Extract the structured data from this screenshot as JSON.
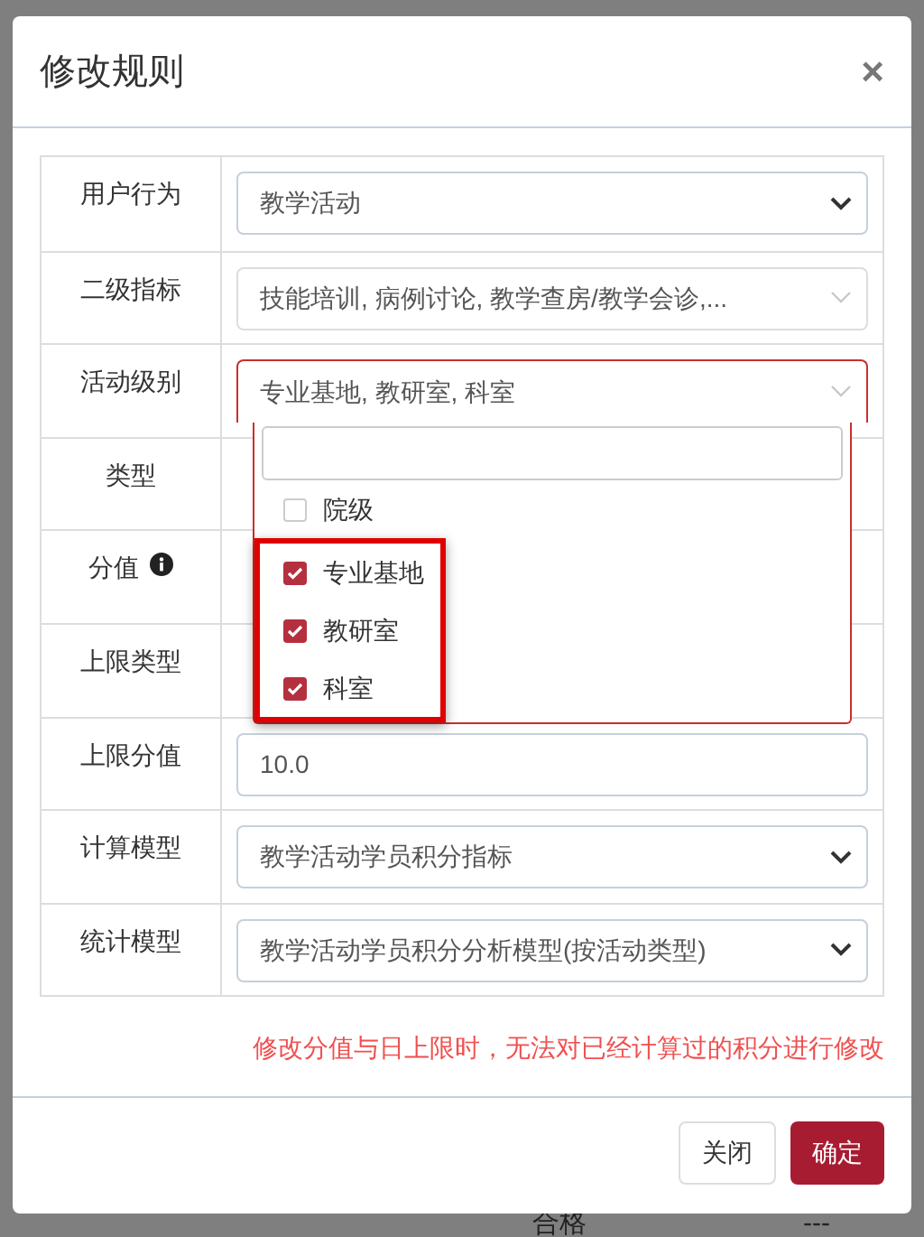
{
  "backdrop": {
    "texts": [
      "合格",
      "---"
    ]
  },
  "modal": {
    "title": "修改规则",
    "close": "×"
  },
  "rows": [
    {
      "label": "用户行为",
      "field": {
        "kind": "select",
        "value": "教学活动"
      }
    },
    {
      "label": "二级指标",
      "field": {
        "kind": "multiselect",
        "value": "技能培训, 病例讨论, 教学查房/教学会诊,...",
        "open": false
      }
    },
    {
      "label": "活动级别",
      "field": {
        "kind": "multiselect",
        "value": "专业基地, 教研室, 科室",
        "open": true,
        "options": [
          {
            "label": "院级",
            "checked": false,
            "highlighted": false
          },
          {
            "label": "专业基地",
            "checked": true,
            "highlighted": true
          },
          {
            "label": "教研室",
            "checked": true,
            "highlighted": true
          },
          {
            "label": "科室",
            "checked": true,
            "highlighted": true
          }
        ]
      }
    },
    {
      "label": "类型"
    },
    {
      "label": "分值",
      "info": true
    },
    {
      "label": "上限类型"
    },
    {
      "label": "上限分值",
      "field": {
        "kind": "input",
        "value": "10.0"
      }
    },
    {
      "label": "计算模型",
      "field": {
        "kind": "select",
        "value": "教学活动学员积分指标"
      }
    },
    {
      "label": "统计模型",
      "field": {
        "kind": "select",
        "value": "教学活动学员积分分析模型(按活动类型)"
      }
    }
  ],
  "note": "修改分值与日上限时，无法对已经计算过的积分进行修改",
  "buttons": [
    {
      "label": "关闭",
      "kind": "default"
    },
    {
      "label": "确定",
      "kind": "primary"
    }
  ]
}
